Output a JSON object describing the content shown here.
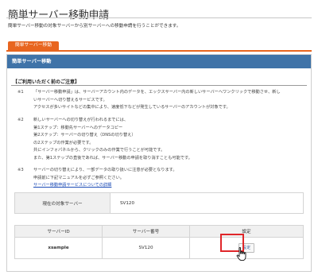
{
  "page": {
    "title": "簡単サーバー移動申請",
    "description": "簡単サーバー移動の対象サーバーから別サーバーへの移動申請を行うことができます。"
  },
  "tab": {
    "label": "簡単サーバー移動"
  },
  "panel": {
    "header": "簡単サーバー移動"
  },
  "notes": {
    "title": "【ご利用いただく前のご注意】",
    "items": [
      {
        "mark": "※1",
        "lines": [
          "「サーバー移動申請」は、サーバーアカウント内のデータを、エックスサーバー内の新しいサーバーへワンクリックで移動させ、新し",
          "いサーバーへ切り替えるサービスです。",
          "アクセスが多いサイトなどの集中により、速度低下などが発生しているサーバーのアカウントが対象です。"
        ]
      },
      {
        "mark": "※2",
        "lines": [
          "新しいサーバーへの切り替えが行われるまでには、",
          "第1ステップ：移動先サーバーへのデータコピー",
          "第2ステップ：サーバーの切り替え（DNSの切り替え）",
          "の2ステップの作業が必要です。",
          "共にインフォパネルから、クリックのみの作業で行うことが可能です。",
          "また、第1ステップの直後であれば、サーバー移動の申請を取り消すことも可能です。"
        ]
      },
      {
        "mark": "※3",
        "lines": [
          "サーバーの切り替えにより、一部データの取り扱いに注意が必要となります。",
          "申請前に下記マニュアルを必ずご参照ください。"
        ],
        "link": "サーバー移動申請サービスについての詳細"
      }
    ]
  },
  "current_server": {
    "label": "現在の対象サーバー",
    "value": "SV120"
  },
  "server_table": {
    "headers": [
      "サーバーID",
      "サーバー番号",
      "設定"
    ],
    "rows": [
      {
        "server_id": "xsample",
        "server_number": "SV120",
        "action": "設定"
      }
    ]
  },
  "colors": {
    "accent": "#e8651f",
    "panel_header": "#3f73a8",
    "highlight": "#e0262a",
    "link": "#1b4bb6"
  }
}
